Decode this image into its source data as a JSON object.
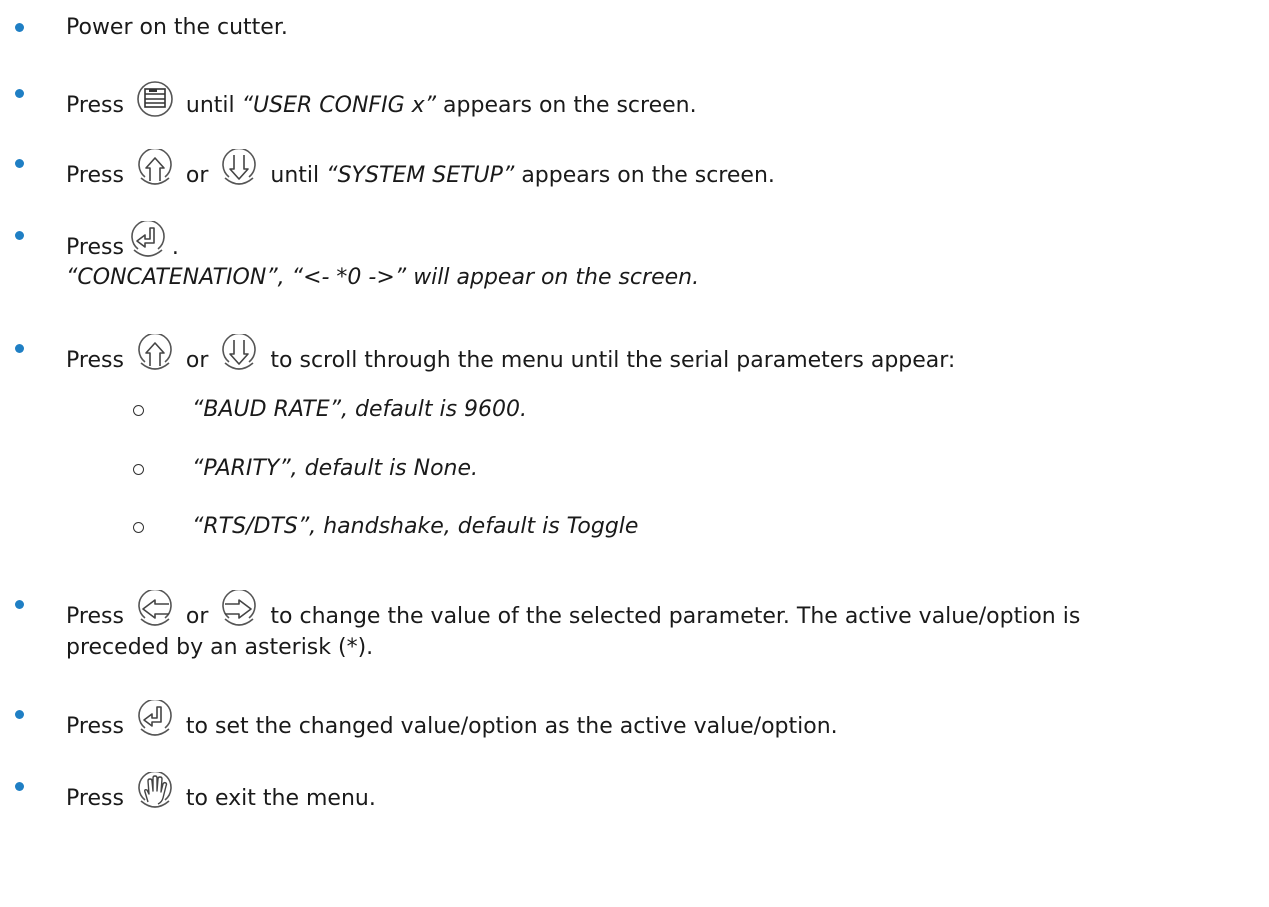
{
  "steps": [
    {
      "text": "Power on the cutter."
    },
    {
      "before": "Press",
      "after": "until",
      "quote": "“USER CONFIG x”",
      "tail": "appears on the screen.",
      "icon": "menu-button-icon"
    },
    {
      "before": "Press",
      "or": "or",
      "after": "until",
      "quote": "“SYSTEM SETUP”",
      "tail": "appears on the screen."
    },
    {
      "before": "Press",
      "after": ".",
      "line2": "“CONCATENATION”, “<-   *0   ->” will appear on the screen."
    },
    {
      "before": "Press",
      "or": "or",
      "after": "to scroll through the menu until the serial parameters appear:"
    },
    {
      "before": "Press",
      "or": "or",
      "after": "to change the value of the selected parameter. The active value/option is",
      "line2": "preceded by an asterisk (*)."
    },
    {
      "before": "Press",
      "after": "to set the changed value/option as the active value/option."
    },
    {
      "before": "Press",
      "after": "to exit the menu."
    }
  ],
  "sub_items": [
    {
      "quote": "“BAUD RATE”",
      "rest": ", default is 9600."
    },
    {
      "quote": "“PARITY”",
      "rest": ", default is None."
    },
    {
      "quote": "“RTS/DTS”",
      "rest": ", handshake, default is Toggle"
    }
  ],
  "icons": {
    "menu": "menu-button-icon",
    "up": "up-arrow-button-icon",
    "down": "down-arrow-button-icon",
    "enter": "enter-button-icon",
    "left": "left-arrow-button-icon",
    "right": "right-arrow-button-icon",
    "stop": "stop-hand-button-icon"
  },
  "colors": {
    "bullet": "#1f7fc4",
    "text": "#1a1a1a"
  }
}
